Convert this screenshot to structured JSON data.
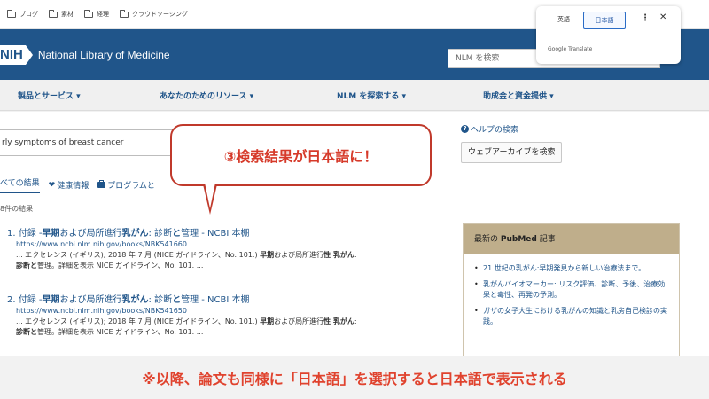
{
  "bookmarks": {
    "items": [
      "ブログ",
      "素材",
      "経理",
      "クラウドソーシング"
    ]
  },
  "header": {
    "logo_text": "NIH",
    "org_name": "National Library of Medicine",
    "search_placeholder": "NLM を検索"
  },
  "nav": {
    "items": [
      "製品とサービス ▾",
      "あなたのためのリソース ▾",
      "NLM を探索する ▾",
      "助成金と資金提供 ▾"
    ]
  },
  "search": {
    "query": "rly symptoms of breast cancer"
  },
  "help": {
    "link_label": "ヘルプの検索",
    "archive_button": "ウェブアーカイブを検索"
  },
  "tabs": {
    "all": "べての結果",
    "health": "健康情報",
    "programs": "プログラムと"
  },
  "results": {
    "count_text": "8件の結果",
    "items": [
      {
        "number": "1.",
        "title_pre": "付録 -",
        "title_b1": "早期",
        "title_mid": "および局所進行",
        "title_b2": "乳がん",
        "title_post": ": 診断",
        "title_b3": "と",
        "title_end": "管理 - NCBI 本棚",
        "url": "https://www.ncbi.nlm.nih.gov/books/NBK541660",
        "snippet_pre": "... エクセレンス (イギリス); 2018 年 7 月 (NICE ガイドライン、No. 101.) ",
        "snippet_b1": "早期",
        "snippet_mid": "および局所進行",
        "snippet_b2": "性 乳がん",
        "snippet_colon": ":",
        "snippet_b3": "診断と",
        "snippet_end": "管理。詳細を表示 NICE ガイドライン、No. 101. ..."
      },
      {
        "number": "2.",
        "title_pre": "付録 -",
        "title_b1": "早期",
        "title_mid": "および局所進行",
        "title_b2": "乳がん",
        "title_post": ": 診断",
        "title_b3": "と",
        "title_end": "管理 - NCBI 本棚",
        "url": "https://www.ncbi.nlm.nih.gov/books/NBK541650",
        "snippet_pre": "... エクセレンス (イギリス); 2018 年 7 月 (NICE ガイドライン、No. 101.) ",
        "snippet_b1": "早期",
        "snippet_mid": "および局所進行",
        "snippet_b2": "性 乳がん",
        "snippet_colon": ":",
        "snippet_b3": "診断と",
        "snippet_end": "管理。詳細を表示 NICE ガイドライン、No. 101. ..."
      }
    ]
  },
  "pubmed": {
    "head_pre": "最新の ",
    "head_b": "PubMed",
    "head_post": " 記事",
    "articles": [
      "21 世紀の乳がん:早期発見から新しい治療法まで。",
      "乳がんバイオマーカー: リスク評価、診断、予後、治療効果と毒性、再発の予測。",
      "ガザの女子大生における乳がんの知識と乳房自己検診の実践。"
    ]
  },
  "callout": {
    "text": "③検索結果が日本語に！"
  },
  "translate": {
    "lang_en": "英語",
    "lang_ja": "日本語",
    "more": "⋮",
    "close": "✕",
    "brand": "Google Translate"
  },
  "caption": {
    "text": "※以降、論文も同様に「日本語」を選択すると日本語で表示される"
  },
  "colors": {
    "nih_blue": "#20558a",
    "accent_red": "#e0432e",
    "pubmed_tan": "#bfae8b"
  }
}
